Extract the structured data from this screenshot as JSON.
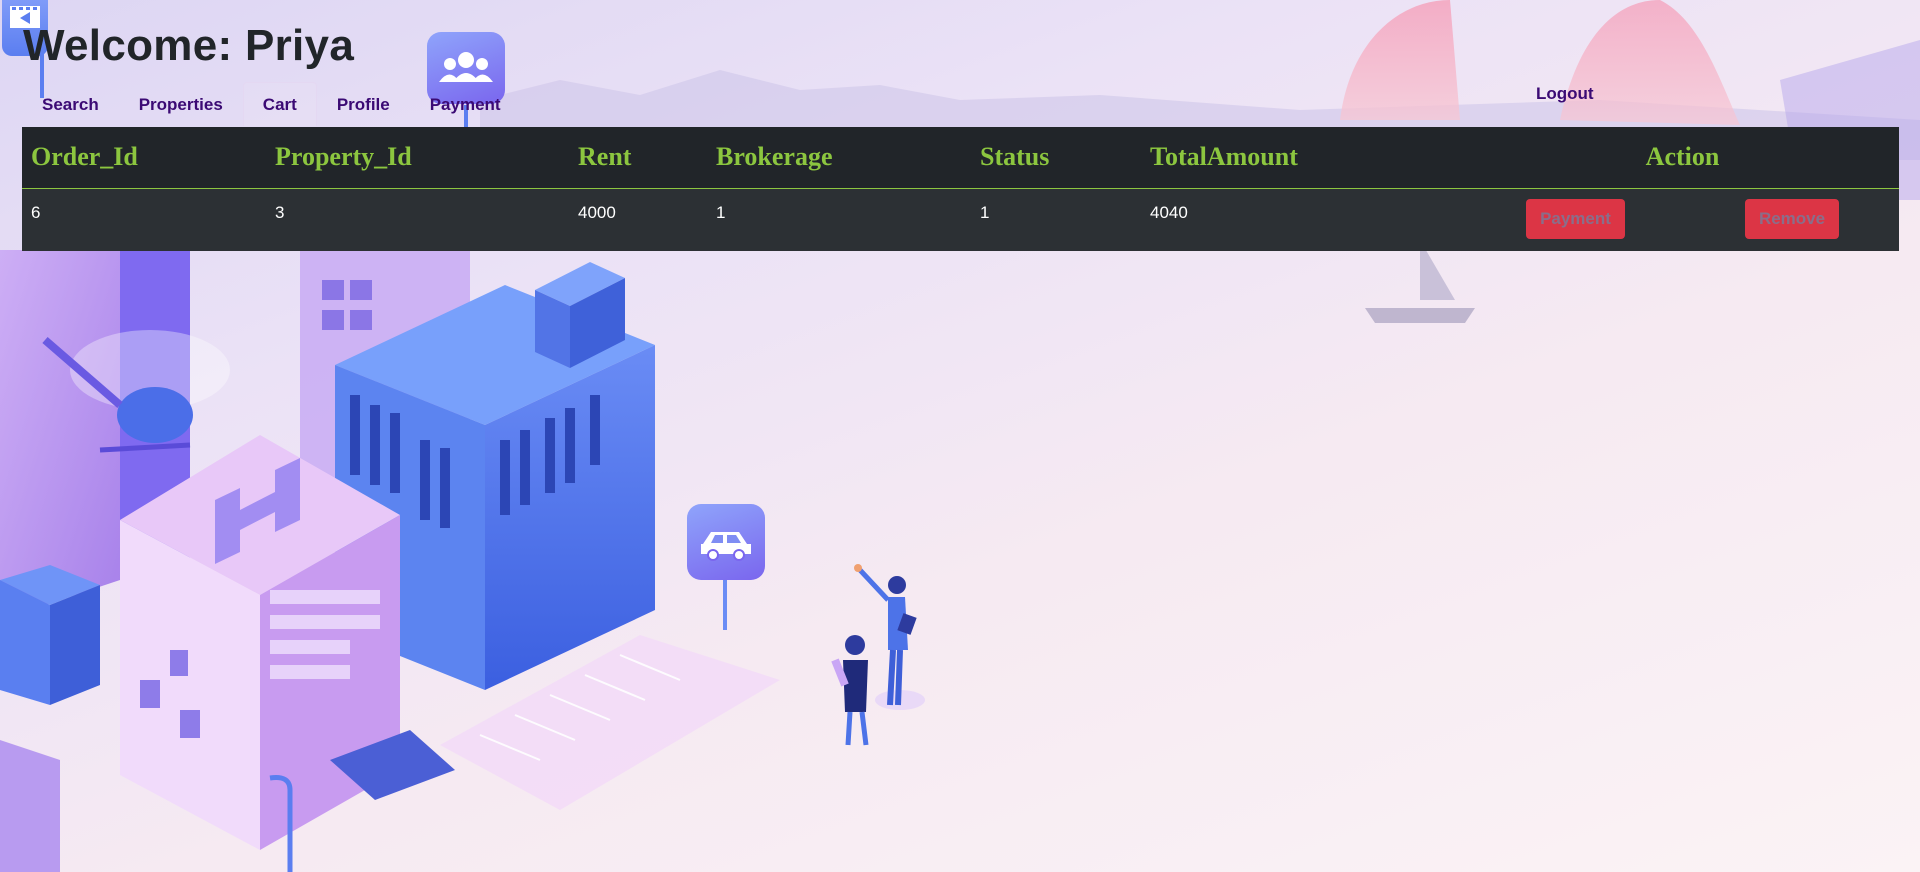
{
  "header": {
    "welcome": "Welcome: Priya"
  },
  "nav": {
    "items": [
      {
        "label": "Search"
      },
      {
        "label": "Properties"
      },
      {
        "label": "Cart",
        "active": true
      },
      {
        "label": "Profile"
      },
      {
        "label": "Payment"
      }
    ],
    "logout": "Logout"
  },
  "table": {
    "columns": [
      "Order_Id",
      "Property_Id",
      "Rent",
      "Brokerage",
      "Status",
      "TotalAmount",
      "Action"
    ],
    "rows": [
      {
        "order_id": "6",
        "property_id": "3",
        "rent": "4000",
        "brokerage": "1",
        "status": "1",
        "total": "4040",
        "pay_label": "Payment",
        "remove_label": "Remove"
      }
    ]
  },
  "colors": {
    "header_bg": "#212529",
    "header_text": "#8cc63f",
    "row_bg": "#2c3034",
    "button_bg": "#dc3545",
    "nav_text": "#3b0a74"
  },
  "icons": [
    "film-icon",
    "users-icon",
    "car-icon"
  ]
}
